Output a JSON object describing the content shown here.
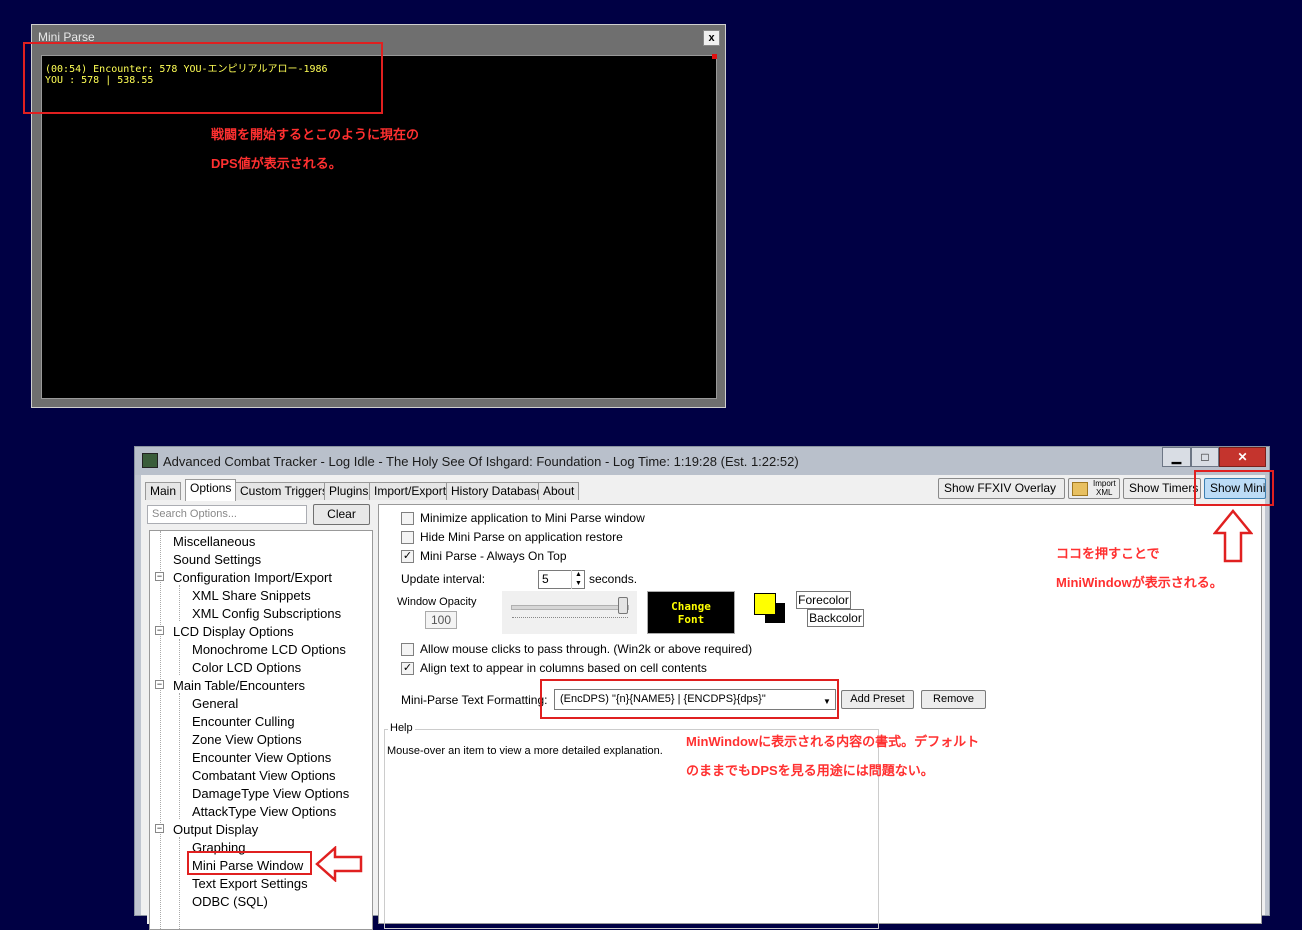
{
  "mini_window": {
    "title": "Mini Parse",
    "close_label": "x",
    "line1": "(00:54) Encounter: 578 YOU-エンピリアルアロー-1986",
    "line2": "YOU : 578 | 538.55"
  },
  "annotations": {
    "mini_note_line1": "戦闘を開始するとこのように現在の",
    "mini_note_line2": "DPS値が表示される。",
    "showmini_note_line1": "ココを押すことで",
    "showmini_note_line2": "MiniWindowが表示される。",
    "format_note_line1": "MinWindowに表示される内容の書式。デフォルト",
    "format_note_line2": "のままでもDPSを見る用途には問題ない。",
    "colors": {
      "highlight": "#e02020"
    }
  },
  "act": {
    "title": "Advanced Combat Tracker - Log Idle - The Holy See Of Ishgard: Foundation - Log Time: 1:19:28 (Est. 1:22:52)",
    "window_buttons": {
      "minimize": "▁",
      "maximize": "□",
      "close": "✕"
    },
    "tabs": [
      "Main",
      "Options",
      "Custom Triggers",
      "Plugins",
      "Import/Export",
      "History Database",
      "About"
    ],
    "toolbar": {
      "overlay": "Show FFXIV Overlay",
      "import_xml_line1": "Import",
      "import_xml_line2": "XML",
      "timers": "Show Timers",
      "show_mini": "Show Mini"
    },
    "search_placeholder": "Search Options...",
    "clear_label": "Clear",
    "tree": [
      "Miscellaneous",
      "Sound Settings",
      "Configuration Import/Export",
      "XML Share Snippets",
      "XML Config Subscriptions",
      "LCD Display Options",
      "Monochrome LCD Options",
      "Color LCD Options",
      "Main Table/Encounters",
      "General",
      "Encounter Culling",
      "Zone View Options",
      "Encounter View Options",
      "Combatant View Options",
      "DamageType View Options",
      "AttackType View Options",
      "Output Display",
      "Graphing",
      "Mini Parse Window",
      "Text Export Settings",
      "ODBC (SQL)"
    ],
    "options": {
      "minimize_to_mini": {
        "label": "Minimize application to Mini Parse window",
        "checked": false
      },
      "hide_on_restore": {
        "label": "Hide Mini Parse on application restore",
        "checked": false
      },
      "always_on_top": {
        "label": "Mini Parse - Always On Top",
        "checked": true
      },
      "update_interval_label": "Update interval:",
      "update_interval_value": "5",
      "seconds_label": "seconds.",
      "opacity_label": "Window Opacity",
      "opacity_value": "100",
      "change_font_line1": "Change",
      "change_font_line2": "Font",
      "forecolor_label": "Forecolor",
      "backcolor_label": "Backcolor",
      "forecolor": "#ffff00",
      "backcolor": "#000000",
      "click_through": {
        "label": "Allow mouse clicks to pass through.   (Win2k or above required)",
        "checked": false
      },
      "align_columns": {
        "label": "Align text to appear in columns based on cell contents",
        "checked": true
      },
      "format_label": "Mini-Parse Text Formatting:",
      "format_value": "(EncDPS) \"{n}{NAME5} | {ENCDPS}{dps}\"",
      "add_preset": "Add Preset",
      "remove": "Remove",
      "help_legend": "Help",
      "help_text": "Mouse-over an item to view a more detailed explanation."
    }
  }
}
